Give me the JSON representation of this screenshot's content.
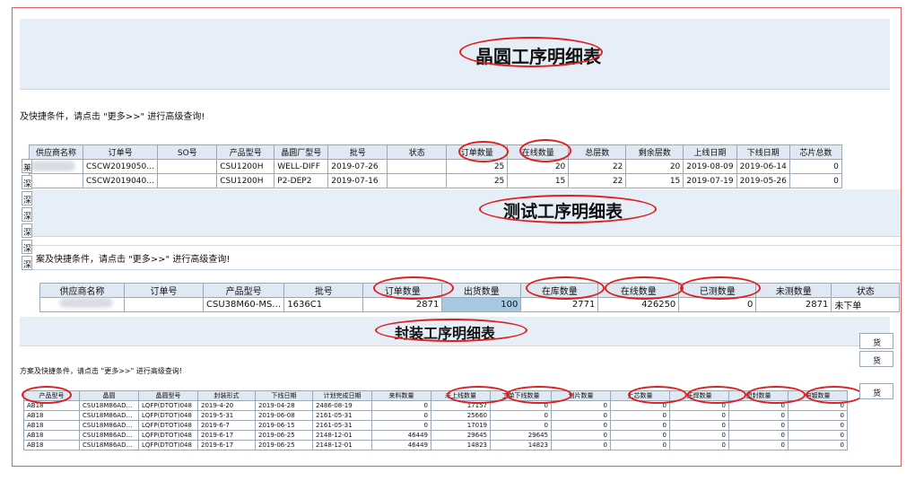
{
  "panel1": {
    "title": "晶圆工序明细表",
    "hint": "及快捷条件，请点击 \"更多>>\" 进行高级查询!",
    "columns": [
      "供应商名称",
      "订单号",
      "SO号",
      "产品型号",
      "晶圆厂型号",
      "批号",
      "状态",
      "订单数量",
      "在线数量",
      "总层数",
      "剩余层数",
      "上线日期",
      "下线日期",
      "芯片总数"
    ],
    "rows": [
      [
        "",
        "CSCW2019050…",
        "",
        "CSU1200H",
        "WELL-DIFF",
        "2019-07-26",
        "",
        "25",
        "20",
        "22",
        "20",
        "2019-08-09",
        "2019-06-14",
        "0"
      ],
      [
        "",
        "CSCW2019040…",
        "",
        "CSU1200H",
        "P2-DEP2",
        "2019-07-16",
        "",
        "25",
        "15",
        "22",
        "15",
        "2019-07-19",
        "2019-05-26",
        "0"
      ]
    ],
    "left_fragments": [
      "莱",
      "深",
      "深",
      "深",
      "深",
      "深",
      "深"
    ]
  },
  "panel2": {
    "title": "测试工序明细表",
    "hint": "案及快捷条件，请点击 \"更多>>\" 进行高级查询!",
    "columns": [
      "供应商名称",
      "订单号",
      "产品型号",
      "批号",
      "订单数量",
      "出货数量",
      "在库数量",
      "在线数量",
      "已测数量",
      "未测数量",
      "状态"
    ],
    "rows": [
      [
        "",
        "",
        "CSU38M60-MS…",
        "1636C1",
        "2871",
        "100",
        "2771",
        "426250",
        "0",
        "2871",
        "未下单"
      ]
    ]
  },
  "panel3": {
    "title": "封装工序明细表",
    "hint": "方案及快捷条件，请点击 \"更多>>\" 进行高级查询!",
    "columns": [
      "产品型号",
      "晶圆",
      "晶圆型号",
      "封装形式",
      "下线日期",
      "计划完成日期",
      "来料数量",
      "未上线数量",
      "工单下线数量",
      "划片数量",
      "上芯数量",
      "压焊数量",
      "塑封数量",
      "电镀数量"
    ],
    "rows": [
      [
        "AB18",
        "CSU18M86AD…",
        "LQFP(DTOT)048",
        "2019-4-20",
        "2019-04-28",
        "2486-08-19",
        "0",
        "17157",
        "0",
        "0",
        "0",
        "0",
        "0",
        "0"
      ],
      [
        "AB18",
        "CSU18M86AD…",
        "LQFP(DTOT)048",
        "2019-5-31",
        "2019-06-08",
        "2161-05-31",
        "0",
        "25660",
        "0",
        "0",
        "0",
        "0",
        "0",
        "0"
      ],
      [
        "AB18",
        "CSU18M86AD…",
        "LQFP(DTOT)048",
        "2019-6-7",
        "2019-06-15",
        "2161-05-31",
        "0",
        "17019",
        "0",
        "0",
        "0",
        "0",
        "0",
        "0"
      ],
      [
        "AB18",
        "CSU18M86AD…",
        "LQFP(DTOT)048",
        "2019-6-17",
        "2019-06-25",
        "2148-12-01",
        "46449",
        "29645",
        "29645",
        "0",
        "0",
        "0",
        "0",
        "0"
      ],
      [
        "AB18",
        "CSU18M86AD…",
        "LQFP(DTOT)048",
        "2019-6-17",
        "2019-06-25",
        "2148-12-01",
        "46449",
        "14823",
        "14823",
        "0",
        "0",
        "0",
        "0",
        "0"
      ]
    ],
    "right_fragments": [
      "货",
      "货",
      "货"
    ]
  }
}
